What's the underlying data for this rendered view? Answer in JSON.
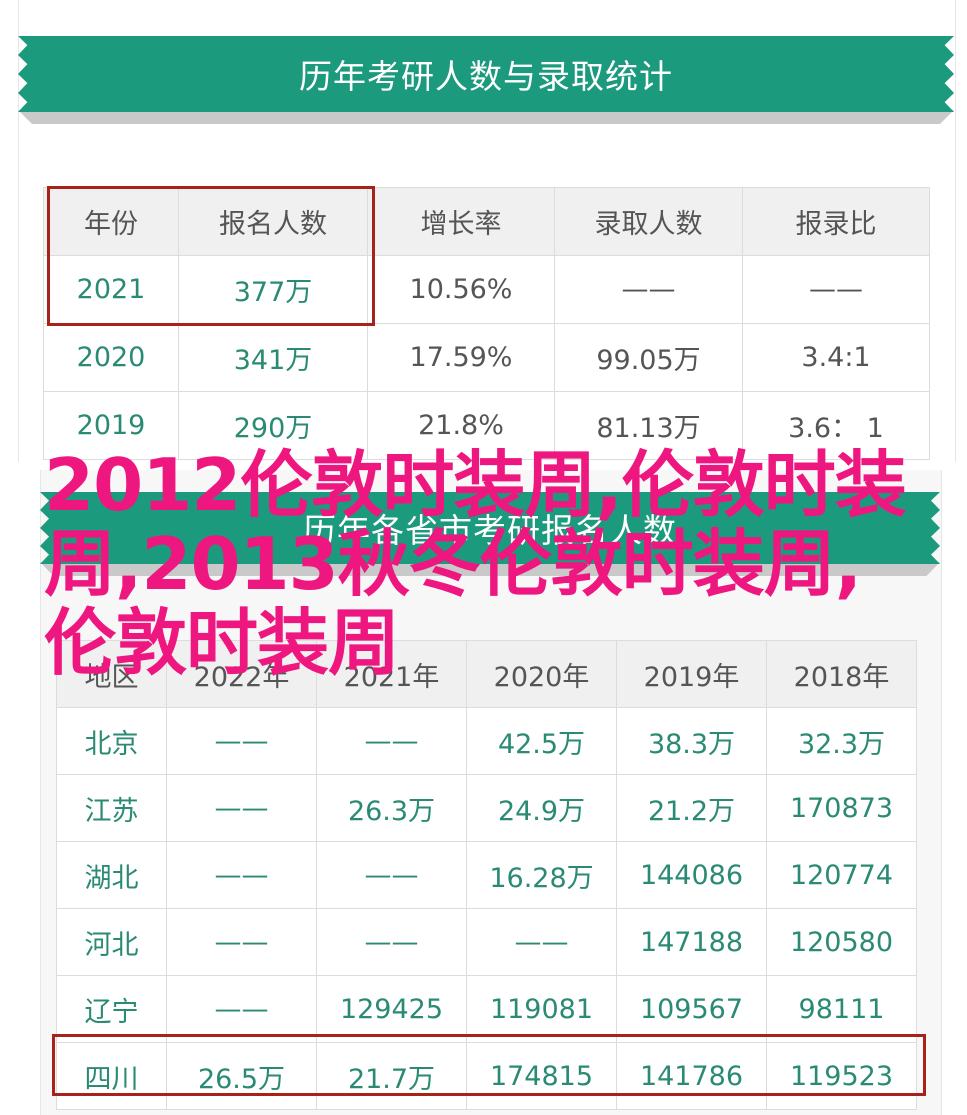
{
  "top_section": {
    "title": "历年考研人数与录取统计",
    "headers": [
      "年份",
      "报名人数",
      "增长率",
      "录取人数",
      "报录比"
    ],
    "rows": [
      [
        "2021",
        "377万",
        "10.56%",
        "——",
        "——"
      ],
      [
        "2020",
        "341万",
        "17.59%",
        "99.05万",
        "3.4:1"
      ],
      [
        "2019",
        "290万",
        "21.8%",
        "81.13万",
        "3.6： 1"
      ]
    ]
  },
  "bottom_section": {
    "title": "历年各省市考研报名人数",
    "headers": [
      "地区",
      "2022年",
      "2021年",
      "2020年",
      "2019年",
      "2018年"
    ],
    "rows": [
      [
        "北京",
        "——",
        "——",
        "42.5万",
        "38.3万",
        "32.3万"
      ],
      [
        "江苏",
        "——",
        "26.3万",
        "24.9万",
        "21.2万",
        "170873"
      ],
      [
        "湖北",
        "——",
        "——",
        "16.28万",
        "144086",
        "120774"
      ],
      [
        "河北",
        "——",
        "——",
        "——",
        "147188",
        "120580"
      ],
      [
        "辽宁",
        "——",
        "129425",
        "119081",
        "109567",
        "98111"
      ],
      [
        "四川",
        "26.5万",
        "21.7万",
        "174815",
        "141786",
        "119523"
      ]
    ]
  },
  "overlay": {
    "text": "2012伦敦时装周,伦敦时装周,2013秋冬伦敦时装周,伦敦时装周"
  },
  "colors": {
    "ribbon": "#1c9a7d",
    "teal_text": "#2a8a73",
    "highlight": "#a8211a",
    "overlay_text": "#ee1780"
  }
}
